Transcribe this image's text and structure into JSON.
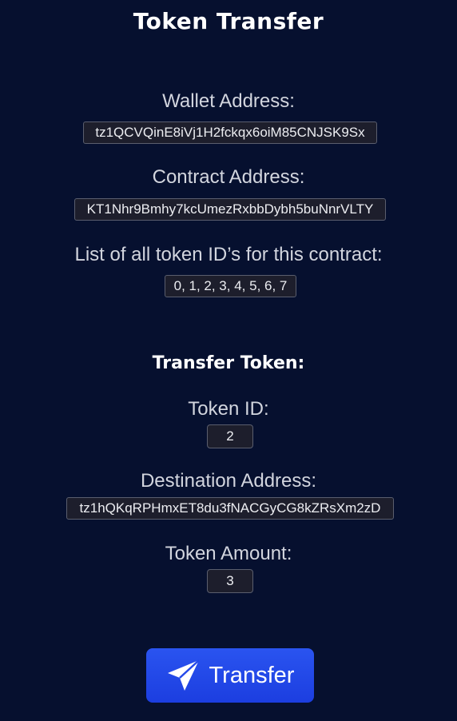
{
  "page": {
    "title": "Token Transfer"
  },
  "wallet": {
    "label": "Wallet Address:",
    "value": "tz1QCVQinE8iVj1H2fckqx6oiM85CNJSK9Sx"
  },
  "contract": {
    "label": "Contract Address:",
    "value": "KT1Nhr9Bmhy7kcUmezRxbbDybh5buNnrVLTY"
  },
  "token_ids": {
    "label": "List of all token ID’s for this contract:",
    "value": "0, 1, 2, 3, 4, 5, 6, 7"
  },
  "transfer": {
    "heading": "Transfer Token:",
    "token_id_label": "Token ID:",
    "token_id_value": "2",
    "destination_label": "Destination Address:",
    "destination_value": "tz1hQKqRPHmxET8du3fNACGyCG8kZRsXm2zD",
    "amount_label": "Token Amount:",
    "amount_value": "3",
    "button_label": "Transfer",
    "button_icon": "paper-plane-icon"
  },
  "colors": {
    "background": "#06102f",
    "button": "#2449ea",
    "field_background": "#1d1e2c"
  }
}
